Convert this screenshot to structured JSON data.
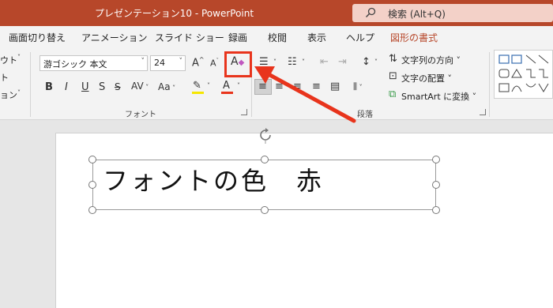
{
  "window": {
    "title": "プレゼンテーション10  -  PowerPoint",
    "search_placeholder": "検索 (Alt+Q)"
  },
  "tabs": [
    {
      "label": "画面切り替え"
    },
    {
      "label": "アニメーション"
    },
    {
      "label": "スライド ショー"
    },
    {
      "label": "録画"
    },
    {
      "label": "校閲"
    },
    {
      "label": "表示"
    },
    {
      "label": "ヘルプ"
    },
    {
      "label": "図形の書式"
    }
  ],
  "left_partial": {
    "layout": "ウト",
    "reset": "ト",
    "section": "ョン"
  },
  "font_group": {
    "font_name": "游ゴシック 本文",
    "font_size": "24",
    "bold": "B",
    "italic": "I",
    "underline": "U",
    "strike": "S",
    "spacing": "AV",
    "case": "Aa",
    "grow": "A",
    "shrink": "A",
    "clear": "A",
    "font_color_letter": "A",
    "group_label": "フォント"
  },
  "paragraph_group": {
    "text_direction": "文字列の方向",
    "align_text": "文字の配置",
    "smartart": "SmartArt に変換",
    "group_label": "段落"
  },
  "slide": {
    "text": "フォントの色　赤"
  },
  "colors": {
    "accent": "#b7472a",
    "highlight": "#e8341c",
    "font_color_bar": "#e8341c",
    "highlighter_bar": "#f5e600"
  }
}
